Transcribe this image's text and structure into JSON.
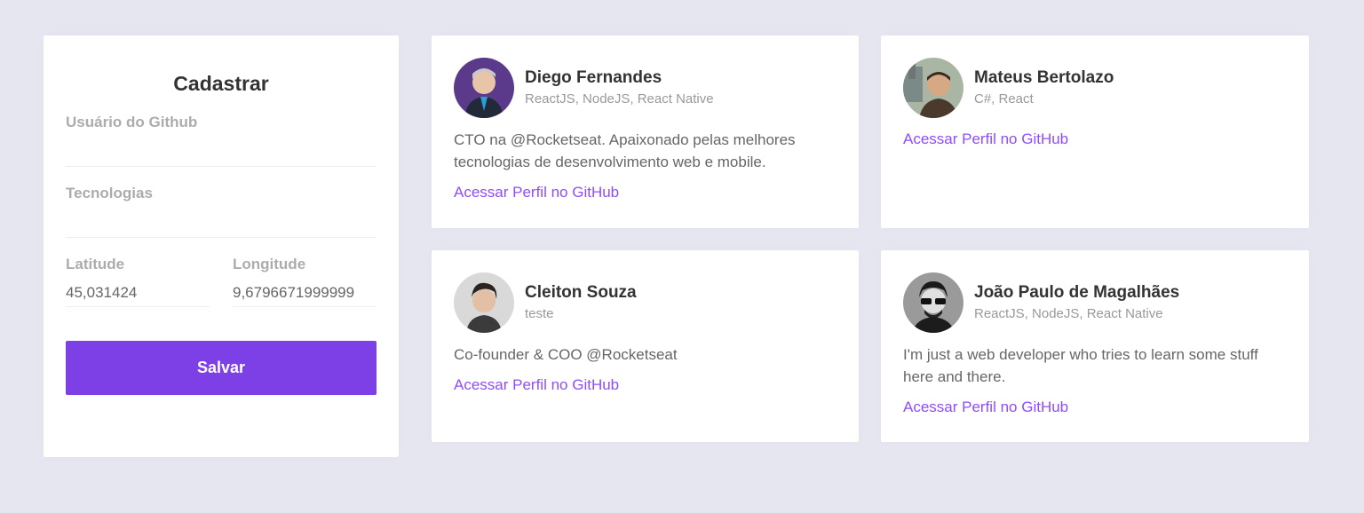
{
  "form": {
    "title": "Cadastrar",
    "github_username_label": "Usuário do Github",
    "github_username_value": "",
    "techs_label": "Tecnologias",
    "techs_value": "",
    "latitude_label": "Latitude",
    "latitude_value": "45,031424",
    "longitude_label": "Longitude",
    "longitude_value": "9,6796671999999",
    "submit_label": "Salvar"
  },
  "devs": [
    {
      "name": "Diego Fernandes",
      "techs": "ReactJS, NodeJS, React Native",
      "bio": "CTO na @Rocketseat. Apaixonado pelas melhores tecnologias de desenvolvimento web e mobile.",
      "link": "Acessar Perfil no GitHub"
    },
    {
      "name": "Mateus Bertolazo",
      "techs": "C#, React",
      "bio": "",
      "link": "Acessar Perfil no GitHub"
    },
    {
      "name": "Cleiton Souza",
      "techs": "teste",
      "bio": "Co-founder & COO @Rocketseat",
      "link": "Acessar Perfil no GitHub"
    },
    {
      "name": "João Paulo de Magalhães",
      "techs": "ReactJS, NodeJS, React Native",
      "bio": "I'm just a web developer who tries to learn some stuff here and there.",
      "link": "Acessar Perfil no GitHub"
    }
  ],
  "colors": {
    "background": "#e6e6f0",
    "accent": "#7d40e7",
    "link": "#8e4dff"
  }
}
